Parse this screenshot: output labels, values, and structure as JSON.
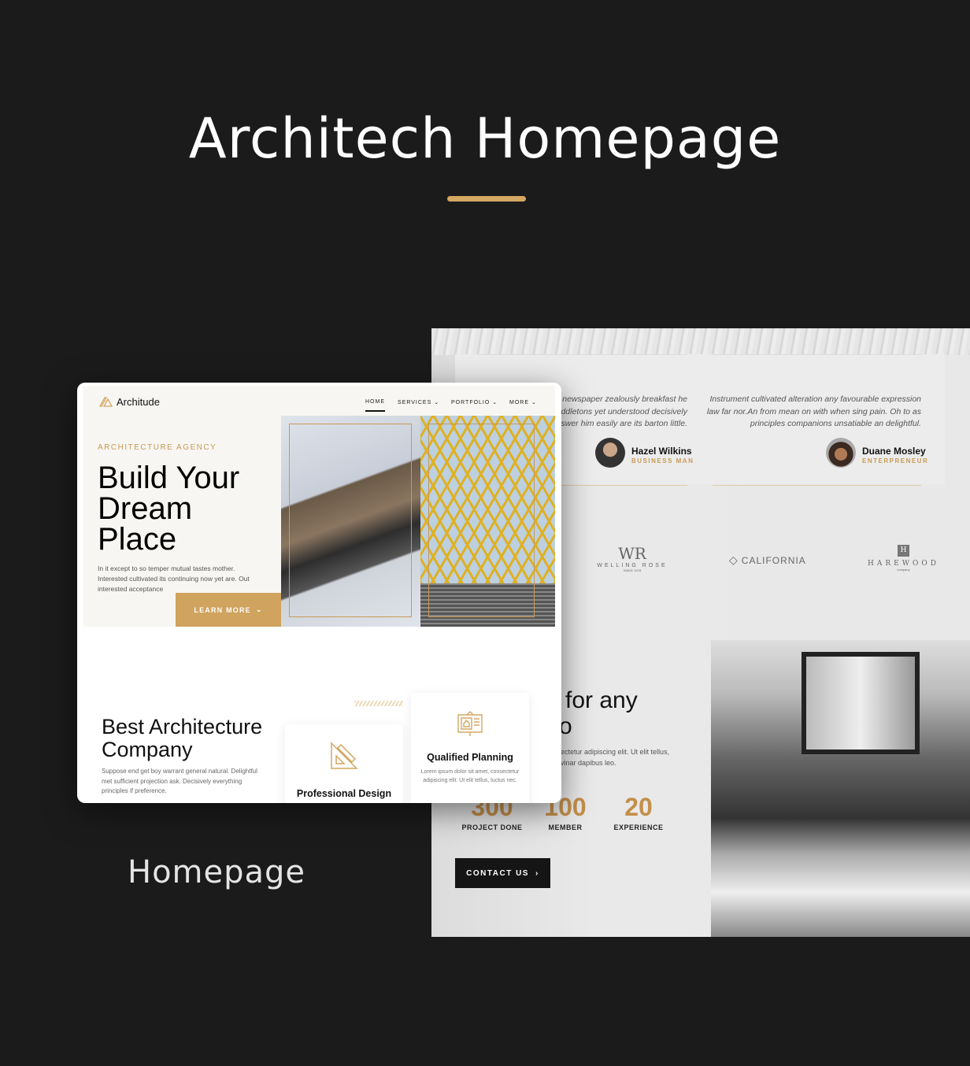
{
  "title": "Architech Homepage",
  "caption": "Homepage",
  "colors": {
    "background": "#1b1b1b",
    "accent": "#d4a762"
  },
  "back": {
    "testimonials": [
      {
        "quote": "ed newspaper zealously breakfast he\nmiddletons yet understood decisively\nAnswer him easily are its barton little.",
        "name": "Hazel Wilkins",
        "role": "BUSINESS MAN"
      },
      {
        "quote": "Instrument cultivated alteration any favourable expression\nlaw far nor.An from mean on with when sing pain. Oh to as\nprinciples companions unsatiable an delightful.",
        "name": "Duane Mosley",
        "role": "ENTERPRENEUR"
      }
    ],
    "logos": [
      {
        "mark": "WR",
        "name": "WELLING ROSE",
        "sub": "SINCE 1978"
      },
      {
        "name": "CALIFORNIA"
      },
      {
        "mark": "H",
        "name": "HAREWOOD",
        "sub": "company"
      }
    ],
    "heading_line1": "for any",
    "heading_line2": "o",
    "paragraph_line1": "ectetur adipiscing elit. Ut elit tellus,",
    "paragraph_line2": "vinar dapibus leo.",
    "stats": [
      {
        "value": "300",
        "label": "PROJECT DONE"
      },
      {
        "value": "100",
        "label": "MEMBER"
      },
      {
        "value": "20",
        "label": "EXPERIENCE"
      }
    ],
    "contact_label": "CONTACT US"
  },
  "front": {
    "brand": "Architude",
    "nav": [
      {
        "label": "HOME"
      },
      {
        "label": "SERVICES"
      },
      {
        "label": "PORTFOLIO"
      },
      {
        "label": "MORE"
      }
    ],
    "eyebrow": "ARCHITECTURE AGENCY",
    "hero_title_1": "Build Your",
    "hero_title_2": "Dream",
    "hero_title_3": "Place",
    "hero_text": "In it except to so temper mutual tastes mother. Interested cultivated its continuing now yet are. Out interested acceptance",
    "learn_more": "LEARN MORE",
    "section_title_1": "Best Architecture",
    "section_title_2": "Company",
    "section_text": "Suppose end get boy warrant general natural. Delightful met sufficient projection ask. Decisively everything principles if preference.",
    "cards": [
      {
        "title": "Professional Design",
        "icon": "ruler-triangle-icon"
      },
      {
        "title": "Qualified Planning",
        "text": "Lorem ipsum dolor sit amet, consectetur adipiscing elit. Ut elit tellus, luctus nec.",
        "icon": "blueprint-board-icon"
      }
    ]
  }
}
